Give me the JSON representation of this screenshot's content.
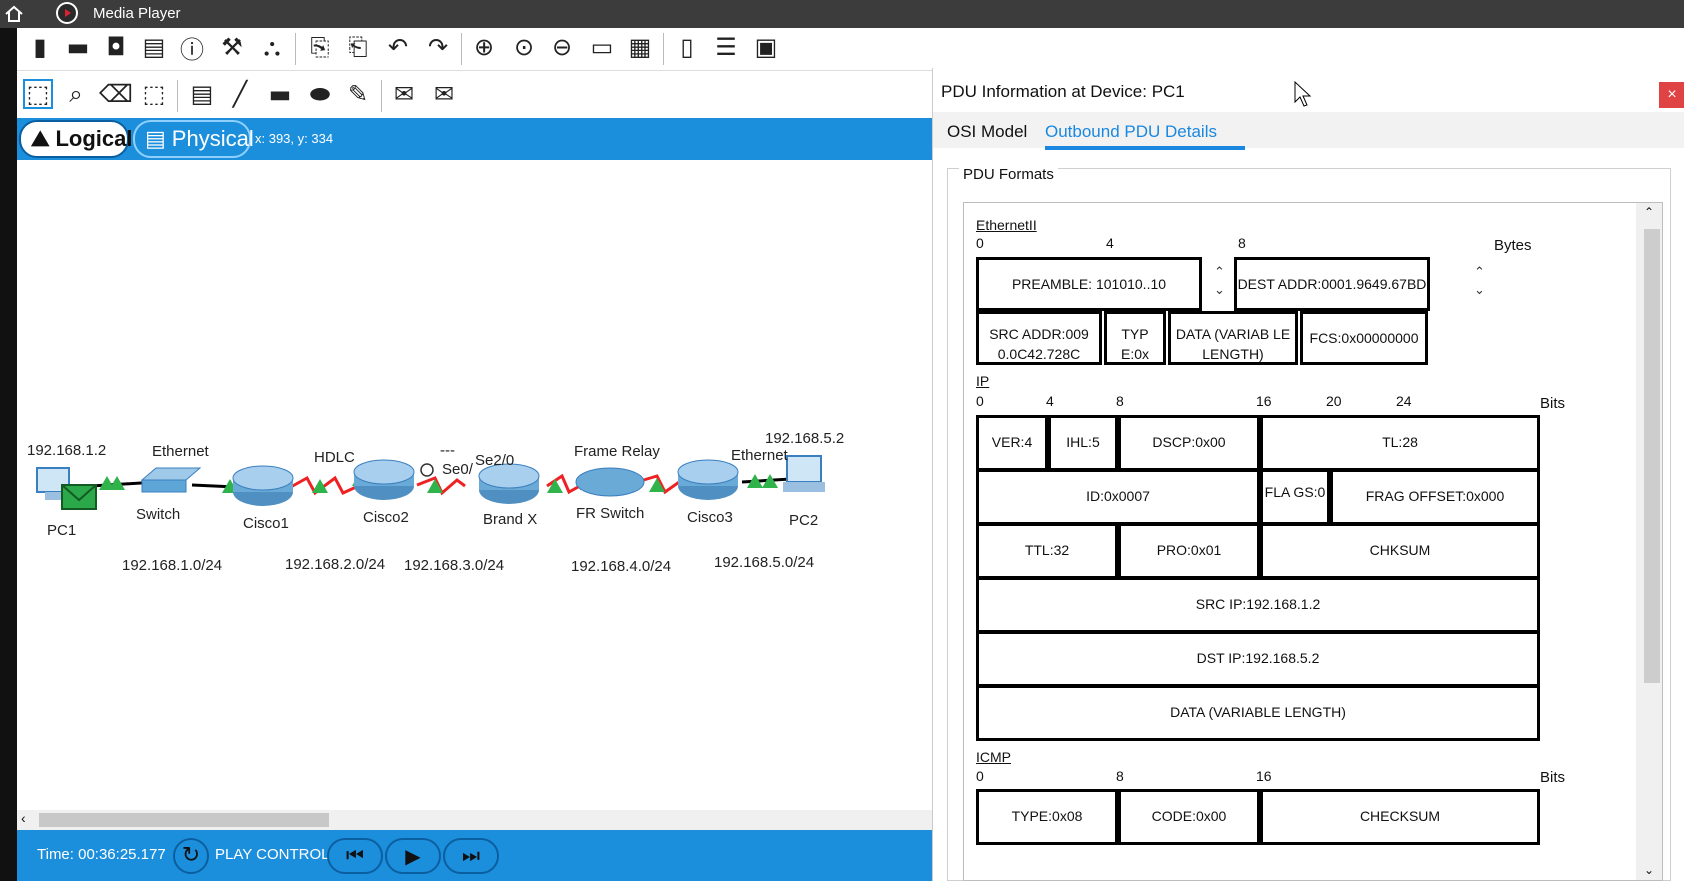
{
  "titlebar": {
    "title": "Media Player"
  },
  "toolbar1": {
    "icons": [
      "new-icon",
      "open-icon",
      "save-icon",
      "print-icon",
      "info-icon",
      "wizard-icon",
      "tool-icon",
      "copy-icon",
      "paste-icon",
      "undo-icon",
      "redo-icon",
      "zoom-in-icon",
      "zoom-reset-icon",
      "zoom-out-icon",
      "palette-icon",
      "custom-device-icon",
      "viewport-icon",
      "pdu-list-icon",
      "camera-icon"
    ]
  },
  "toolbar2": {
    "icons": [
      "select-icon",
      "inspect-icon",
      "delete-icon",
      "resize-icon",
      "note-icon",
      "line-icon",
      "rectangle-icon",
      "ellipse-icon",
      "freeform-icon",
      "add-simple-pdu-icon",
      "add-complex-pdu-icon"
    ]
  },
  "modebar": {
    "logical": "Logical",
    "physical": "Physical",
    "coords": "x: 393, y: 334"
  },
  "topology": {
    "labels": {
      "pc1_ip": "192.168.1.2",
      "pc1": "PC1",
      "ethernet1": "Ethernet",
      "switch": "Switch",
      "cisco1": "Cisco1",
      "hdlc": "HDLC",
      "cisco2": "Cisco2",
      "dashes": "---",
      "se0": "Se0/",
      "se2": "Se2/0",
      "brandx": "Brand X",
      "framerelay": "Frame Relay",
      "frswitch": "FR Switch",
      "cisco3": "Cisco3",
      "ethernet2": "Ethernet",
      "pc2_ip": "192.168.5.2",
      "pc2": "PC2",
      "net1": "192.168.1.0/24",
      "net2": "192.168.2.0/24",
      "net3": "192.168.3.0/24",
      "net4": "192.168.4.0/24",
      "net5": "192.168.5.0/24"
    }
  },
  "status": {
    "time": "Time: 00:36:25.177",
    "play_controls": "PLAY CONTROLS:"
  },
  "dialog": {
    "title": "PDU Information at Device: PC1",
    "close": "×",
    "tabs": [
      "OSI Model",
      "Outbound PDU Details"
    ],
    "formats_label": "PDU Formats",
    "ethernet": {
      "name": "EthernetII",
      "unit": "Bytes",
      "ruler": [
        "0",
        "4",
        "8"
      ],
      "preamble": "PREAMBLE: 101010..10",
      "dest": "DEST ADDR:0001.9649.67BD",
      "src": "SRC ADDR:009 0.0C42.728C",
      "type": "TYP E:0x",
      "data": "DATA (VARIAB LE LENGTH)",
      "fcs": "FCS:0x00000000"
    },
    "ip": {
      "name": "IP",
      "unit": "Bits",
      "ruler": [
        "0",
        "4",
        "8",
        "16",
        "20",
        "24"
      ],
      "ver": "VER:4",
      "ihl": "IHL:5",
      "dscp": "DSCP:0x00",
      "tl": "TL:28",
      "id": "ID:0x0007",
      "flags": "FLA GS:0",
      "frag": "FRAG OFFSET:0x000",
      "ttl": "TTL:32",
      "pro": "PRO:0x01",
      "chksum": "CHKSUM",
      "src": "SRC IP:192.168.1.2",
      "dst": "DST IP:192.168.5.2",
      "data": "DATA (VARIABLE LENGTH)"
    },
    "icmp": {
      "name": "ICMP",
      "unit": "Bits",
      "ruler": [
        "0",
        "8",
        "16"
      ],
      "type": "TYPE:0x08",
      "code": "CODE:0x00",
      "chksum": "CHECKSUM"
    }
  }
}
